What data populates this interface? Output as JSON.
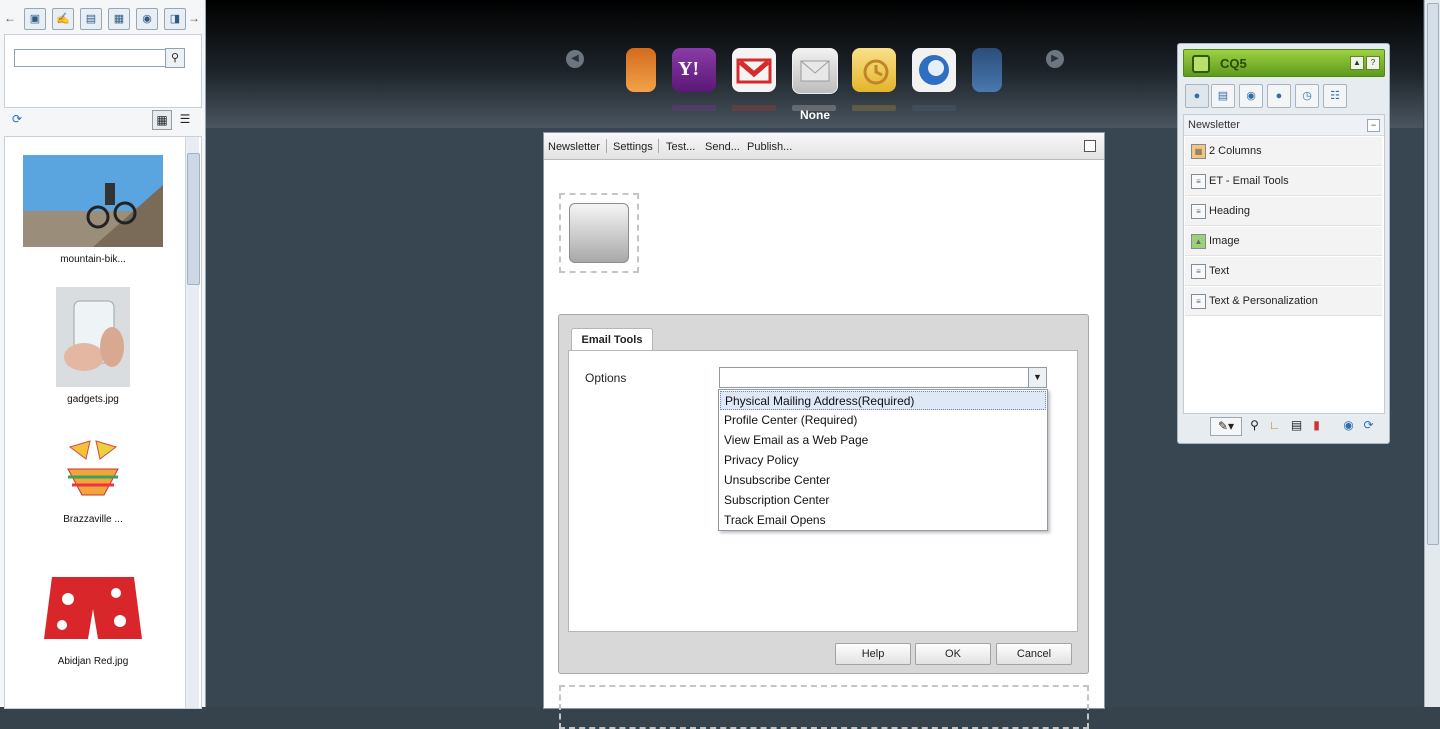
{
  "finder": {
    "search_placeholder": "",
    "assets": [
      {
        "name": "mountain-bik..."
      },
      {
        "name": "gadgets.jpg"
      },
      {
        "name": "Brazzaville ..."
      },
      {
        "name": "Abidjan Red.jpg"
      }
    ]
  },
  "carousel": {
    "selected_label": "None"
  },
  "page_toolbar": {
    "items": [
      "Newsletter",
      "Settings",
      "Test...",
      "Send...",
      "Publish..."
    ]
  },
  "dialog": {
    "tab_label": "Email Tools",
    "options_label": "Options",
    "options_value": "",
    "dropdown_items": [
      "Physical Mailing Address(Required)",
      "Profile Center (Required)",
      "View Email as a Web Page",
      "Privacy Policy",
      "Unsubscribe Center",
      "Subscription Center",
      "Track Email Opens"
    ],
    "buttons": {
      "help": "Help",
      "ok": "OK",
      "cancel": "Cancel"
    }
  },
  "sidekick": {
    "title": "CQ5",
    "group_label": "Newsletter",
    "components": [
      "2 Columns",
      "ET - Email Tools",
      "Heading",
      "Image",
      "Text",
      "Text & Personalization"
    ]
  },
  "colors": {
    "stage_bg": "#384651",
    "sidekick_green": "#7ab32e",
    "selection_blue": "#dfe8f6"
  }
}
